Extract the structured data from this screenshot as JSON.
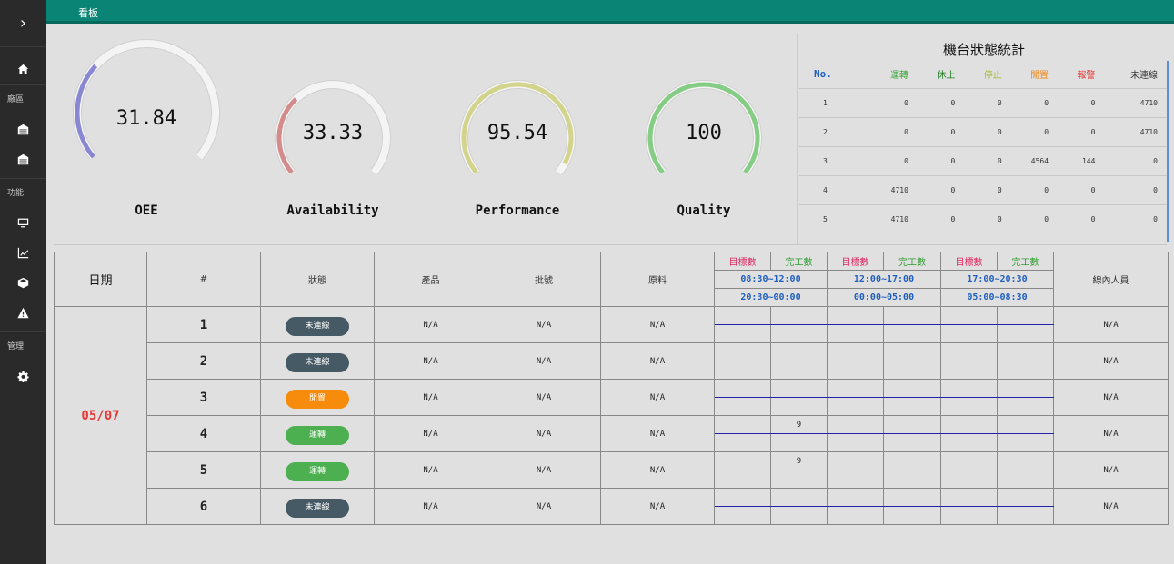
{
  "topbar": {
    "title": "看板"
  },
  "sidebar": {
    "toggle": "›",
    "sec_area": "廠區",
    "sec_func": "功能",
    "sec_admin": "管理"
  },
  "gauges": [
    {
      "name": "OEE",
      "value": "31.84",
      "color": "#8a87d2",
      "fraction": 0.3184
    },
    {
      "name": "Availability",
      "value": "33.33",
      "color": "#d48b8b",
      "fraction": 0.3333
    },
    {
      "name": "Performance",
      "value": "95.54",
      "color": "#d2d48b",
      "fraction": 0.9554
    },
    {
      "name": "Quality",
      "value": "100",
      "color": "#85cc85",
      "fraction": 1.0
    }
  ],
  "machine_stats": {
    "title": "機台狀態統計",
    "headers": [
      "No.",
      "運轉",
      "休止",
      "停止",
      "閒置",
      "報警",
      "未連線"
    ],
    "header_colors": [
      "#1f5fbf",
      "#3aa63a",
      "#1c7a1c",
      "#a8b832",
      "#f08a1c",
      "#e53935",
      "#333333"
    ],
    "rows": [
      [
        "1",
        "0",
        "0",
        "0",
        "0",
        "0",
        "4710"
      ],
      [
        "2",
        "0",
        "0",
        "0",
        "0",
        "0",
        "4710"
      ],
      [
        "3",
        "0",
        "0",
        "0",
        "4564",
        "144",
        "0"
      ],
      [
        "4",
        "4710",
        "0",
        "0",
        "0",
        "0",
        "0"
      ],
      [
        "5",
        "4710",
        "0",
        "0",
        "0",
        "0",
        "0"
      ]
    ]
  },
  "main_table": {
    "h_date": "日期",
    "h_num": "#",
    "h_status": "狀態",
    "h_product": "產品",
    "h_batch": "批號",
    "h_material": "原料",
    "h_target": "目標數",
    "h_done": "完工數",
    "times_top": [
      "08:30~12:00",
      "12:00~17:00",
      "17:00~20:30"
    ],
    "times_bottom": [
      "20:30~00:00",
      "00:00~05:00",
      "05:00~08:30"
    ],
    "h_staff": "線內人員",
    "date": "05/07",
    "rows": [
      {
        "num": "1",
        "status": "未連線",
        "color": "#455a64",
        "product": "N/A",
        "batch": "N/A",
        "material": "N/A",
        "done1": "",
        "staff": "N/A"
      },
      {
        "num": "2",
        "status": "未連線",
        "color": "#455a64",
        "product": "N/A",
        "batch": "N/A",
        "material": "N/A",
        "done1": "",
        "staff": "N/A"
      },
      {
        "num": "3",
        "status": "閒置",
        "color": "#f78c0c",
        "product": "N/A",
        "batch": "N/A",
        "material": "N/A",
        "done1": "",
        "staff": "N/A"
      },
      {
        "num": "4",
        "status": "運轉",
        "color": "#4caf50",
        "product": "N/A",
        "batch": "N/A",
        "material": "N/A",
        "done1": "9",
        "staff": "N/A"
      },
      {
        "num": "5",
        "status": "運轉",
        "color": "#4caf50",
        "product": "N/A",
        "batch": "N/A",
        "material": "N/A",
        "done1": "9",
        "staff": "N/A"
      },
      {
        "num": "6",
        "status": "未連線",
        "color": "#455a64",
        "product": "N/A",
        "batch": "N/A",
        "material": "N/A",
        "done1": "",
        "staff": "N/A"
      }
    ]
  }
}
